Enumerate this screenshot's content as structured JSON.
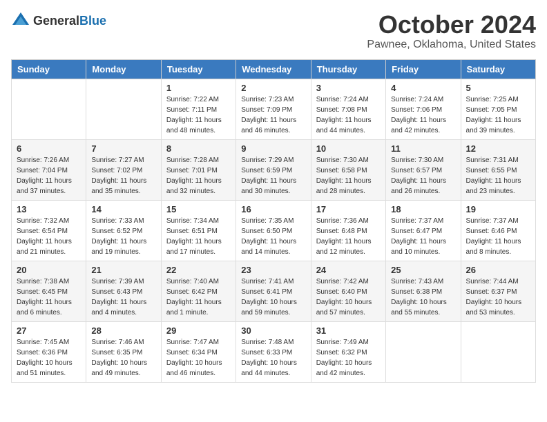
{
  "logo": {
    "general": "General",
    "blue": "Blue"
  },
  "title": "October 2024",
  "subtitle": "Pawnee, Oklahoma, United States",
  "headers": [
    "Sunday",
    "Monday",
    "Tuesday",
    "Wednesday",
    "Thursday",
    "Friday",
    "Saturday"
  ],
  "weeks": [
    [
      {
        "day": "",
        "info": ""
      },
      {
        "day": "",
        "info": ""
      },
      {
        "day": "1",
        "info": "Sunrise: 7:22 AM\nSunset: 7:11 PM\nDaylight: 11 hours and 48 minutes."
      },
      {
        "day": "2",
        "info": "Sunrise: 7:23 AM\nSunset: 7:09 PM\nDaylight: 11 hours and 46 minutes."
      },
      {
        "day": "3",
        "info": "Sunrise: 7:24 AM\nSunset: 7:08 PM\nDaylight: 11 hours and 44 minutes."
      },
      {
        "day": "4",
        "info": "Sunrise: 7:24 AM\nSunset: 7:06 PM\nDaylight: 11 hours and 42 minutes."
      },
      {
        "day": "5",
        "info": "Sunrise: 7:25 AM\nSunset: 7:05 PM\nDaylight: 11 hours and 39 minutes."
      }
    ],
    [
      {
        "day": "6",
        "info": "Sunrise: 7:26 AM\nSunset: 7:04 PM\nDaylight: 11 hours and 37 minutes."
      },
      {
        "day": "7",
        "info": "Sunrise: 7:27 AM\nSunset: 7:02 PM\nDaylight: 11 hours and 35 minutes."
      },
      {
        "day": "8",
        "info": "Sunrise: 7:28 AM\nSunset: 7:01 PM\nDaylight: 11 hours and 32 minutes."
      },
      {
        "day": "9",
        "info": "Sunrise: 7:29 AM\nSunset: 6:59 PM\nDaylight: 11 hours and 30 minutes."
      },
      {
        "day": "10",
        "info": "Sunrise: 7:30 AM\nSunset: 6:58 PM\nDaylight: 11 hours and 28 minutes."
      },
      {
        "day": "11",
        "info": "Sunrise: 7:30 AM\nSunset: 6:57 PM\nDaylight: 11 hours and 26 minutes."
      },
      {
        "day": "12",
        "info": "Sunrise: 7:31 AM\nSunset: 6:55 PM\nDaylight: 11 hours and 23 minutes."
      }
    ],
    [
      {
        "day": "13",
        "info": "Sunrise: 7:32 AM\nSunset: 6:54 PM\nDaylight: 11 hours and 21 minutes."
      },
      {
        "day": "14",
        "info": "Sunrise: 7:33 AM\nSunset: 6:52 PM\nDaylight: 11 hours and 19 minutes."
      },
      {
        "day": "15",
        "info": "Sunrise: 7:34 AM\nSunset: 6:51 PM\nDaylight: 11 hours and 17 minutes."
      },
      {
        "day": "16",
        "info": "Sunrise: 7:35 AM\nSunset: 6:50 PM\nDaylight: 11 hours and 14 minutes."
      },
      {
        "day": "17",
        "info": "Sunrise: 7:36 AM\nSunset: 6:48 PM\nDaylight: 11 hours and 12 minutes."
      },
      {
        "day": "18",
        "info": "Sunrise: 7:37 AM\nSunset: 6:47 PM\nDaylight: 11 hours and 10 minutes."
      },
      {
        "day": "19",
        "info": "Sunrise: 7:37 AM\nSunset: 6:46 PM\nDaylight: 11 hours and 8 minutes."
      }
    ],
    [
      {
        "day": "20",
        "info": "Sunrise: 7:38 AM\nSunset: 6:45 PM\nDaylight: 11 hours and 6 minutes."
      },
      {
        "day": "21",
        "info": "Sunrise: 7:39 AM\nSunset: 6:43 PM\nDaylight: 11 hours and 4 minutes."
      },
      {
        "day": "22",
        "info": "Sunrise: 7:40 AM\nSunset: 6:42 PM\nDaylight: 11 hours and 1 minute."
      },
      {
        "day": "23",
        "info": "Sunrise: 7:41 AM\nSunset: 6:41 PM\nDaylight: 10 hours and 59 minutes."
      },
      {
        "day": "24",
        "info": "Sunrise: 7:42 AM\nSunset: 6:40 PM\nDaylight: 10 hours and 57 minutes."
      },
      {
        "day": "25",
        "info": "Sunrise: 7:43 AM\nSunset: 6:38 PM\nDaylight: 10 hours and 55 minutes."
      },
      {
        "day": "26",
        "info": "Sunrise: 7:44 AM\nSunset: 6:37 PM\nDaylight: 10 hours and 53 minutes."
      }
    ],
    [
      {
        "day": "27",
        "info": "Sunrise: 7:45 AM\nSunset: 6:36 PM\nDaylight: 10 hours and 51 minutes."
      },
      {
        "day": "28",
        "info": "Sunrise: 7:46 AM\nSunset: 6:35 PM\nDaylight: 10 hours and 49 minutes."
      },
      {
        "day": "29",
        "info": "Sunrise: 7:47 AM\nSunset: 6:34 PM\nDaylight: 10 hours and 46 minutes."
      },
      {
        "day": "30",
        "info": "Sunrise: 7:48 AM\nSunset: 6:33 PM\nDaylight: 10 hours and 44 minutes."
      },
      {
        "day": "31",
        "info": "Sunrise: 7:49 AM\nSunset: 6:32 PM\nDaylight: 10 hours and 42 minutes."
      },
      {
        "day": "",
        "info": ""
      },
      {
        "day": "",
        "info": ""
      }
    ]
  ]
}
